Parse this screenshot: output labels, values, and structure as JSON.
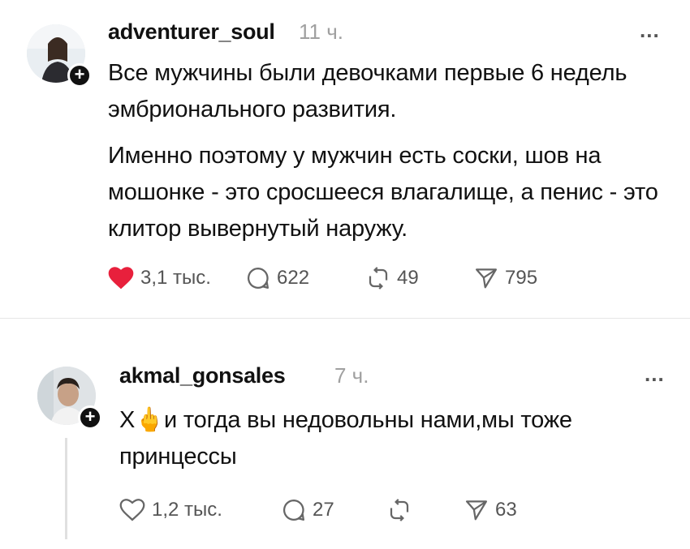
{
  "posts": [
    {
      "username": "adventurer_soul",
      "time": "11 ч.",
      "more": "...",
      "plus": "+",
      "paragraphs": [
        "Все мужчины были девочками первые 6 недель эмбрионального развития.",
        "Именно поэтому у мужчин есть соски, шов на мошонке - это сросшееся влагалище, а пенис - это клитор вывернутый наружу."
      ],
      "likes": "3,1 тыс.",
      "comments": "622",
      "reposts": "49",
      "shares": "795",
      "liked": true,
      "like_color": "#e8203c"
    },
    {
      "username": "akmal_gonsales",
      "time": "7 ч.",
      "more": "...",
      "plus": "+",
      "paragraphs": [
        "Х🖕и тогда вы недовольны нами,мы тоже принцессы"
      ],
      "likes": "1,2 тыс.",
      "comments": "27",
      "reposts": "",
      "shares": "63",
      "liked": false
    }
  ]
}
